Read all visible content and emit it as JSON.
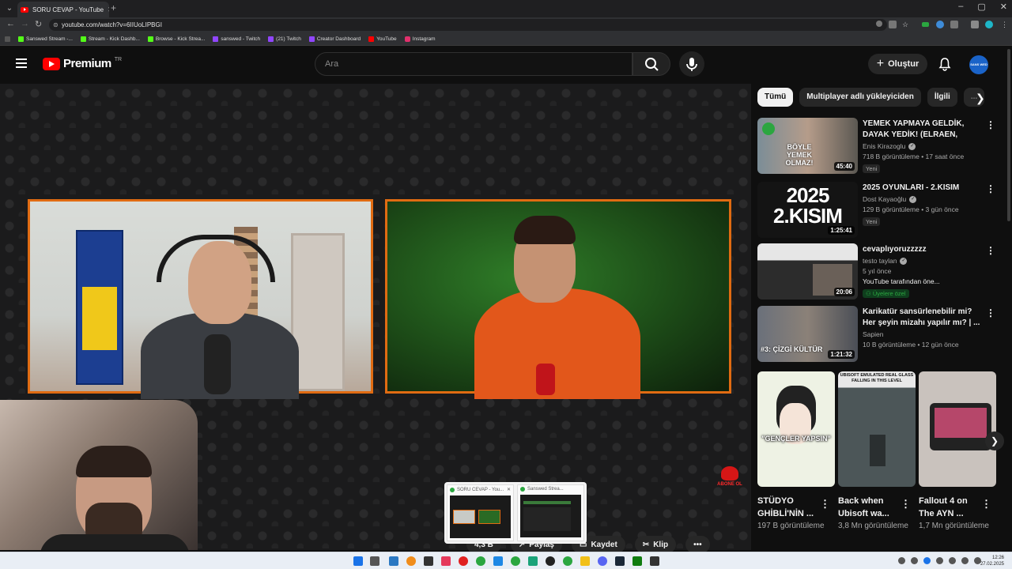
{
  "browser": {
    "tab_title": "SORU CEVAP - YouTube",
    "tab_close": "✕",
    "new_tab": "+",
    "url": "youtube.com/watch?v=6IIUoLIPBGI",
    "bookmarks": [
      {
        "label": "Sanswed Stream -...",
        "color": "#53fc18"
      },
      {
        "label": "Stream - Kick Dashb...",
        "color": "#53fc18"
      },
      {
        "label": "Browse - Kick Strea...",
        "color": "#53fc18"
      },
      {
        "label": "sanswed - Twitch",
        "color": "#9146ff"
      },
      {
        "label": "(21) Twitch",
        "color": "#9146ff"
      },
      {
        "label": "Creator Dashboard",
        "color": "#9146ff"
      },
      {
        "label": "YouTube",
        "color": "#ff0000"
      },
      {
        "label": "Instagram",
        "color": "#e1306c"
      }
    ]
  },
  "header": {
    "brand": "Premium",
    "region": "TR",
    "search_placeholder": "Ara",
    "create_label": "Oluştur",
    "avatar_text": "SANS WED"
  },
  "chips": [
    "Tümü",
    "Multiplayer adlı yükleyiciden",
    "İlgili",
    "..."
  ],
  "recommendations": [
    {
      "title": "YEMEK YAPMAYA GELDİK, DAYAK YEDİK! (ELRAEN, ERAY,...",
      "channel": "Enis Kirazoglu",
      "verified": true,
      "stats": "718 B görüntüleme • 17 saat önce",
      "badge": "Yeni",
      "duration": "45:40",
      "thumb_color": "#6d7a84",
      "thumb_text": "BÖYLE YEMEK OLMAZ!"
    },
    {
      "title": "2025 OYUNLARI - 2.KISIM",
      "channel": "Dost Kayaoğlu",
      "verified": true,
      "stats": "129 B görüntüleme • 3 gün önce",
      "badge": "Yeni",
      "duration": "1:25:41",
      "thumb_color": "#1a1a1a",
      "thumb_text": "2025 2.KISIM"
    },
    {
      "title": "cevaplıyoruzzzzz",
      "channel": "testo taylan",
      "verified": true,
      "stats": "5 yıl önce",
      "extra": "YouTube tarafından öne...",
      "badge": "Üyelere özel",
      "duration": "20:06",
      "thumb_color": "#2a2a2a",
      "thumb_text": ""
    },
    {
      "title": "Karikatür sansürlenebilir mi? Her şeyin mizahı yapılır mı? | ...",
      "channel": "Sapien",
      "verified": false,
      "stats": "10 B görüntüleme • 12 gün önce",
      "duration": "1:21:32",
      "thumb_color": "#505560",
      "thumb_text": "#3: ÇİZGİ KÜLTÜR"
    }
  ],
  "shorts": [
    {
      "title": "STÜDYO GHİBLİ'NİN ...",
      "views": "197 B görüntüleme",
      "thumb_color": "#e9f0e0",
      "thumb_text": "\"GENÇLER YAPSIN\""
    },
    {
      "title": "Back when Ubisoft wa...",
      "views": "3,8 Mn görüntüleme",
      "thumb_color": "#5f6a6c",
      "thumb_text": "UBISOFT EMULATED REAL GLASS FALLING IN THIS LEVEL"
    },
    {
      "title": "Fallout 4 on The AYN ...",
      "views": "1,7 Mn görüntüleme",
      "thumb_color": "#c9c2bd",
      "thumb_text": ""
    }
  ],
  "actions": {
    "share": "Paylaş",
    "save": "Kaydet",
    "clip": "Klip",
    "likes": "4,3 B",
    "more": "•••"
  },
  "overlay": {
    "abone_label": "ABONE OL"
  },
  "previews": [
    {
      "title": "SORU CEVAP - You...",
      "close": "✕"
    },
    {
      "title": "Sanswed Strea...",
      "close": ""
    }
  ],
  "taskbar": {
    "time": "12:26",
    "date": "27.02.2025"
  }
}
